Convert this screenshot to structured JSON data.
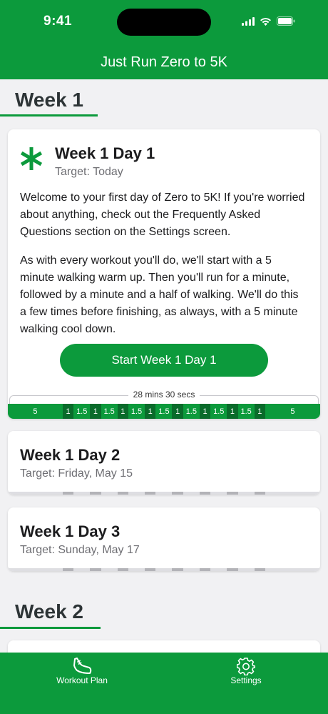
{
  "status_bar": {
    "time": "9:41"
  },
  "nav": {
    "title": "Just Run Zero to 5K"
  },
  "weeks": [
    {
      "title": "Week 1",
      "days": [
        {
          "title": "Week 1 Day 1",
          "target": "Target: Today",
          "paragraphs": [
            "Welcome to your first day of Zero to 5K! If you're worried about anything, check out the Frequently Asked Questions section on the Settings screen.",
            "As with every workout you'll do, we'll start with a 5 minute walking warm up. Then you'll run for a minute, followed by a minute and a half of walking. We'll do this a few times before finishing, as always, with a 5 minute walking cool down."
          ],
          "start_button": "Start Week 1 Day 1",
          "total_duration": "28 mins 30 secs",
          "segments": [
            {
              "label": "5",
              "minutes": 5,
              "kind": "walk"
            },
            {
              "label": "1",
              "minutes": 1,
              "kind": "run"
            },
            {
              "label": "1.5",
              "minutes": 1.5,
              "kind": "walk"
            },
            {
              "label": "1",
              "minutes": 1,
              "kind": "run"
            },
            {
              "label": "1.5",
              "minutes": 1.5,
              "kind": "walk"
            },
            {
              "label": "1",
              "minutes": 1,
              "kind": "run"
            },
            {
              "label": "1.5",
              "minutes": 1.5,
              "kind": "walk"
            },
            {
              "label": "1",
              "minutes": 1,
              "kind": "run"
            },
            {
              "label": "1.5",
              "minutes": 1.5,
              "kind": "walk"
            },
            {
              "label": "1",
              "minutes": 1,
              "kind": "run"
            },
            {
              "label": "1.5",
              "minutes": 1.5,
              "kind": "walk"
            },
            {
              "label": "1",
              "minutes": 1,
              "kind": "run"
            },
            {
              "label": "1.5",
              "minutes": 1.5,
              "kind": "walk"
            },
            {
              "label": "1",
              "minutes": 1,
              "kind": "run"
            },
            {
              "label": "1.5",
              "minutes": 1.5,
              "kind": "walk"
            },
            {
              "label": "1",
              "minutes": 1,
              "kind": "run"
            },
            {
              "label": "5",
              "minutes": 5,
              "kind": "walk"
            }
          ]
        },
        {
          "title": "Week 1 Day 2",
          "target": "Target: Friday, May 15"
        },
        {
          "title": "Week 1 Day 3",
          "target": "Target: Sunday, May 17"
        }
      ]
    },
    {
      "title": "Week 2"
    }
  ],
  "tabs": [
    {
      "label": "Workout Plan",
      "icon": "running-shoe-icon"
    },
    {
      "label": "Settings",
      "icon": "gear-icon"
    }
  ],
  "colors": {
    "brand_green": "#0c9a3c",
    "run_segment": "#0a6b2b",
    "background": "#f1f1f3"
  }
}
